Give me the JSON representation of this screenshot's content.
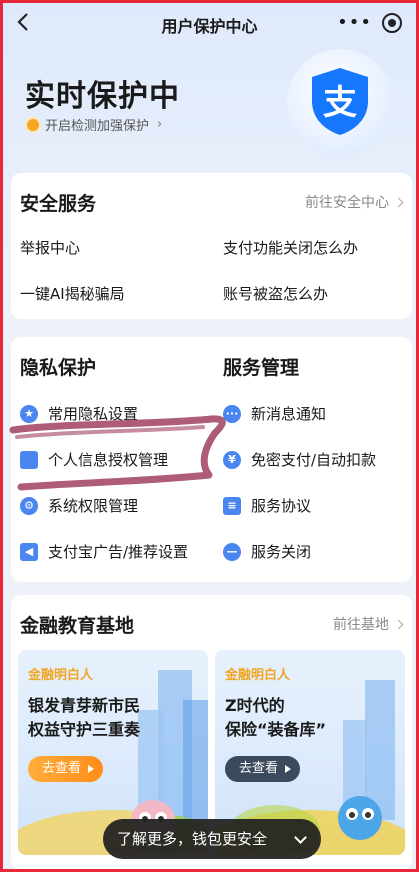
{
  "nav": {
    "title": "用户保护中心",
    "more": "•••"
  },
  "hero": {
    "title": "实时保护中",
    "subtitle": "开启检测加强保护",
    "shield_char": "支"
  },
  "security": {
    "title": "安全服务",
    "link": "前往安全中心",
    "items": [
      "举报中心",
      "支付功能关闭怎么办",
      "一键AI揭秘骗局",
      "账号被盗怎么办"
    ]
  },
  "privacy": {
    "title": "隐私保护",
    "items": [
      "常用隐私设置",
      "个人信息授权管理",
      "系统权限管理",
      "支付宝广告/推荐设置"
    ]
  },
  "service": {
    "title": "服务管理",
    "items": [
      "新消息通知",
      "免密支付/自动扣款",
      "服务协议",
      "服务关闭"
    ]
  },
  "finance": {
    "title": "金融教育基地",
    "link": "前往基地",
    "cards": [
      {
        "tag": "金融明白人",
        "line1": "银发青芽新市民",
        "line2": "权益守护三重奏",
        "button": "去查看"
      },
      {
        "tag": "金融明白人",
        "line1": "Z时代的",
        "line2": "保险“装备库”",
        "button": "去查看"
      }
    ]
  },
  "toast": {
    "text": "了解更多，钱包更安全"
  },
  "colors": {
    "accent": "#1677ff",
    "border": "#e8283a",
    "highlight": "#a0405f"
  }
}
